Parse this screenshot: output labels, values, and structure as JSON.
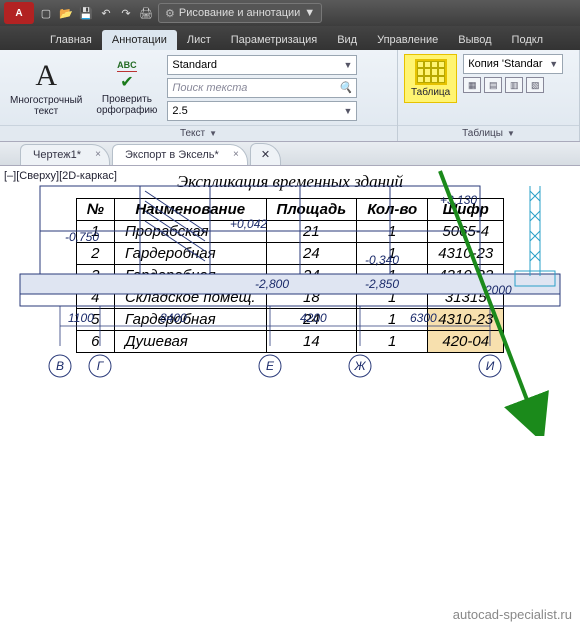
{
  "qat": {
    "logo": "A",
    "workspace": "Рисование и аннотации"
  },
  "tabs": [
    "Главная",
    "Аннотации",
    "Лист",
    "Параметризация",
    "Вид",
    "Управление",
    "Вывод",
    "Подкл"
  ],
  "active_tab": 1,
  "ribbon": {
    "mtext": "Многострочный\nтекст",
    "spell_hint": "ABC",
    "spell": "Проверить\nорфографию",
    "style_combo": "Standard",
    "find_placeholder": "Поиск текста",
    "height_combo": "2.5",
    "panel_text": "Текст",
    "table_btn": "Таблица",
    "copy_combo": "Копия 'Standar",
    "panel_tables": "Таблицы"
  },
  "doctabs": [
    {
      "label": "Чертеж1*"
    },
    {
      "label": "Экспорт в Эксель*"
    }
  ],
  "active_doctab": 1,
  "view_label": "[–][Сверху][2D-каркас]",
  "drawing_labels": {
    "a": "+3,130",
    "b": "+0,042",
    "c": "-0,750",
    "d": "-2,800",
    "e": "-0,340",
    "f": "-2,850",
    "g": "2000",
    "dim1": "1100",
    "dim2": "8400",
    "dim3": "4200",
    "dim4": "6300",
    "ax1": "В",
    "ax2": "Г",
    "ax3": "Е",
    "ax4": "Ж",
    "ax5": "И"
  },
  "table_title": "Экспликация временных зданий",
  "table_headers": [
    "№",
    "Наименование",
    "Площадь",
    "Кол-во",
    "Шифр"
  ],
  "table_rows": [
    {
      "n": "1",
      "name": "Прорабская",
      "area": "21",
      "qty": "1",
      "code": "5065-4"
    },
    {
      "n": "2",
      "name": "Гардеробная",
      "area": "24",
      "qty": "1",
      "code": "4310-23"
    },
    {
      "n": "3",
      "name": "Гардеробная",
      "area": "24",
      "qty": "1",
      "code": "4310-23"
    },
    {
      "n": "4",
      "name": "Складское помещ.",
      "area": "18",
      "qty": "1",
      "code": "31315"
    },
    {
      "n": "5",
      "name": "Гардеробная",
      "area": "24",
      "qty": "1",
      "code": "4310-23"
    },
    {
      "n": "6",
      "name": "Душевая",
      "area": "14",
      "qty": "1",
      "code": "420-04"
    }
  ],
  "watermark": "autocad-specialist.ru"
}
